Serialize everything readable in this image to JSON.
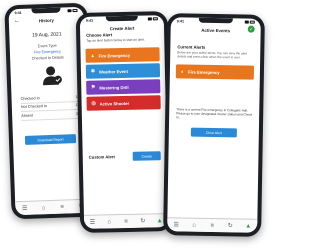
{
  "phones": {
    "history": {
      "time": "9:41",
      "title": "History",
      "date": "19 Aug, 2021",
      "event_type_label": "Event Type",
      "event_type_value": "Fire Emergency",
      "checked_in_label": "Checked In Details",
      "stats": [
        {
          "label": "Checked In",
          "value": "11"
        },
        {
          "label": "Not Checked In",
          "value": "13"
        },
        {
          "label": "Absent",
          "value": "36"
        }
      ],
      "button_label": "Download Report"
    },
    "create": {
      "time": "9:41",
      "title": "Create Alert",
      "choose_title": "Choose Alert",
      "choose_desc": "Tap an alert button below to start an alert.",
      "alerts": [
        {
          "label": "Fire Emergency",
          "icon": "fire-icon",
          "glyph": "🔥",
          "color": "#e8761f"
        },
        {
          "label": "Weather Event",
          "icon": "snowflake-icon",
          "glyph": "❄",
          "color": "#2e8fd6"
        },
        {
          "label": "Mustering Drill",
          "icon": "person-icon",
          "glyph": "⚑",
          "color": "#7a3fbf"
        },
        {
          "label": "Active Shooter",
          "icon": "target-icon",
          "glyph": "◎",
          "color": "#d42b2b"
        }
      ],
      "custom_label": "Custom Alert",
      "create_button": "Create"
    },
    "active": {
      "time": "9:41",
      "title": "Active Events",
      "current_alerts": "Current Alerts",
      "desc": "Below are your active alerts. You can view the alert details and press clear when the event is over.",
      "alert_label": "Fire Emergency",
      "alert_color": "#e8761f",
      "info": "There is a current Fire emergency in Collegiate Hall. Please go to your designated muster station and Check In.",
      "clear_button": "Clear Alert"
    }
  }
}
